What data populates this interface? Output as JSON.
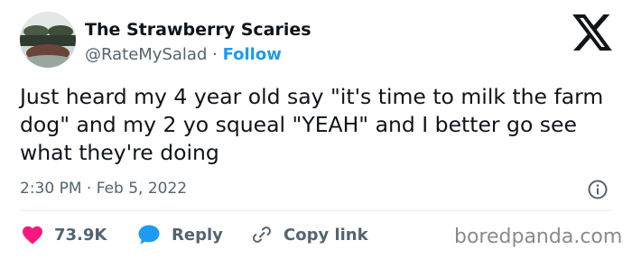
{
  "author": {
    "name": "The Strawberry Scaries",
    "handle": "@RateMySalad",
    "separator": "·",
    "follow_label": "Follow"
  },
  "tweet": {
    "text": "Just heard my 4 year old say \"it's time to milk the farm dog\" and my 2 yo squeal \"YEAH\" and I better go see what they're doing",
    "time": "2:30 PM",
    "separator": "·",
    "date": "Feb 5, 2022"
  },
  "actions": {
    "likes": "73.9K",
    "reply_label": "Reply",
    "copy_label": "Copy link"
  },
  "watermark": "boredpanda.com",
  "icons": {
    "logo": "x-logo-icon",
    "info": "info-icon",
    "like": "heart-icon",
    "reply": "speech-bubble-icon",
    "copy": "link-icon"
  },
  "colors": {
    "heart": "#f91880",
    "reply": "#1d9bf0",
    "follow": "#1d9bf0",
    "secondary_text": "#536471"
  }
}
